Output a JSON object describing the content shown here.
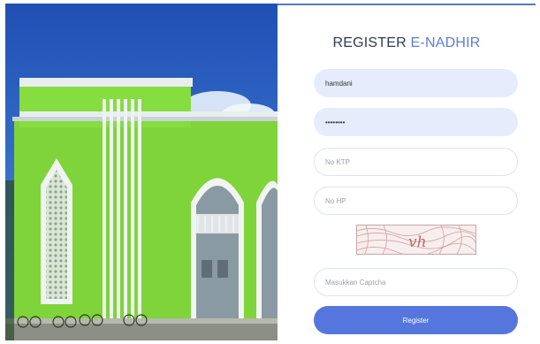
{
  "form": {
    "title_prefix": "REGISTER",
    "title_brand": "E-NADHIR",
    "username_value": "hamdani",
    "password_value": "hamdani1",
    "ktp_placeholder": "No KTP",
    "hp_placeholder": "No HP",
    "captcha_text": "vh",
    "captcha_placeholder": "Masukkan Captcha",
    "register_label": "Register"
  },
  "colors": {
    "accent": "#5577dd",
    "brand_text": "#5a7ed2",
    "filled_field_bg": "#e6ecfb"
  },
  "hero": {
    "icon": "mosque-photo"
  }
}
